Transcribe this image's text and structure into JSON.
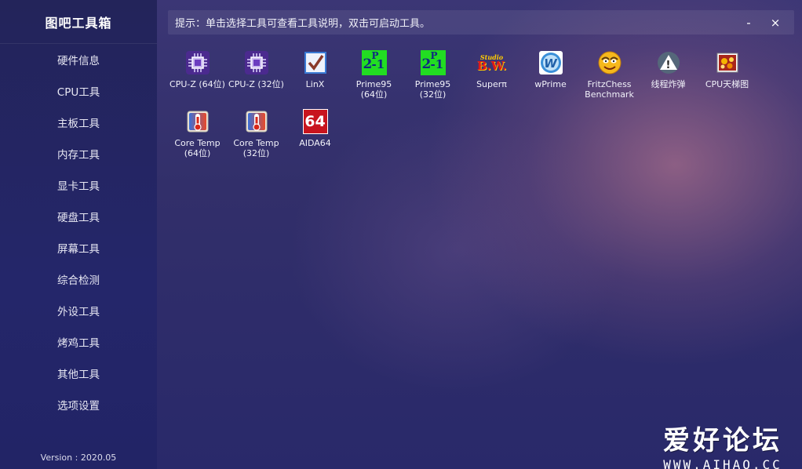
{
  "app": {
    "title": "图吧工具箱",
    "version": "Version : 2020.05"
  },
  "sidebar": {
    "items": [
      {
        "label": "硬件信息",
        "active": true
      },
      {
        "label": "CPU工具"
      },
      {
        "label": "主板工具"
      },
      {
        "label": "内存工具"
      },
      {
        "label": "显卡工具"
      },
      {
        "label": "硬盘工具"
      },
      {
        "label": "屏幕工具"
      },
      {
        "label": "综合检测"
      },
      {
        "label": "外设工具"
      },
      {
        "label": "烤鸡工具"
      },
      {
        "label": "其他工具"
      },
      {
        "label": "选项设置"
      }
    ]
  },
  "header": {
    "hint": "提示：单击选择工具可查看工具说明，双击可启动工具。",
    "minimize_label": "-",
    "close_label": "×"
  },
  "tools": [
    {
      "label1": "CPU-Z (64位)",
      "label2": "",
      "icon": "cpu-z-icon"
    },
    {
      "label1": "CPU-Z (32位)",
      "label2": "",
      "icon": "cpu-z-icon"
    },
    {
      "label1": "LinX",
      "label2": "",
      "icon": "checkbox-icon"
    },
    {
      "label1": "Prime95",
      "label2": "(64位)",
      "icon": "prime95-icon"
    },
    {
      "label1": "Prime95",
      "label2": "(32位)",
      "icon": "prime95-icon"
    },
    {
      "label1": "Superπ",
      "label2": "",
      "icon": "superpi-icon"
    },
    {
      "label1": "wPrime",
      "label2": "",
      "icon": "wprime-icon"
    },
    {
      "label1": "FritzChess",
      "label2": "Benchmark",
      "icon": "fritz-face-icon"
    },
    {
      "label1": "线程炸弹",
      "label2": "",
      "icon": "warning-icon"
    },
    {
      "label1": "CPU天梯图",
      "label2": "",
      "icon": "cpu-ladder-icon"
    },
    {
      "label1": "Core Temp",
      "label2": "(64位)",
      "icon": "thermometer-icon"
    },
    {
      "label1": "Core Temp",
      "label2": "(32位)",
      "icon": "thermometer-icon"
    },
    {
      "label1": "AIDA64",
      "label2": "",
      "icon": "aida64-icon"
    }
  ],
  "icon_text": {
    "prime": "2",
    "prime_exp": "P",
    "prime_minus": "-1",
    "aida": "64",
    "superpi_top": "Studio",
    "superpi_main": "B.W.",
    "wprime": "W",
    "warning": "!"
  },
  "watermark": {
    "main": "爱好论坛",
    "url": "WWW.AIHAO.CC"
  },
  "colors": {
    "sidebar": "#23245a",
    "accent_green": "#22dd22",
    "aida_red": "#c8141e"
  }
}
